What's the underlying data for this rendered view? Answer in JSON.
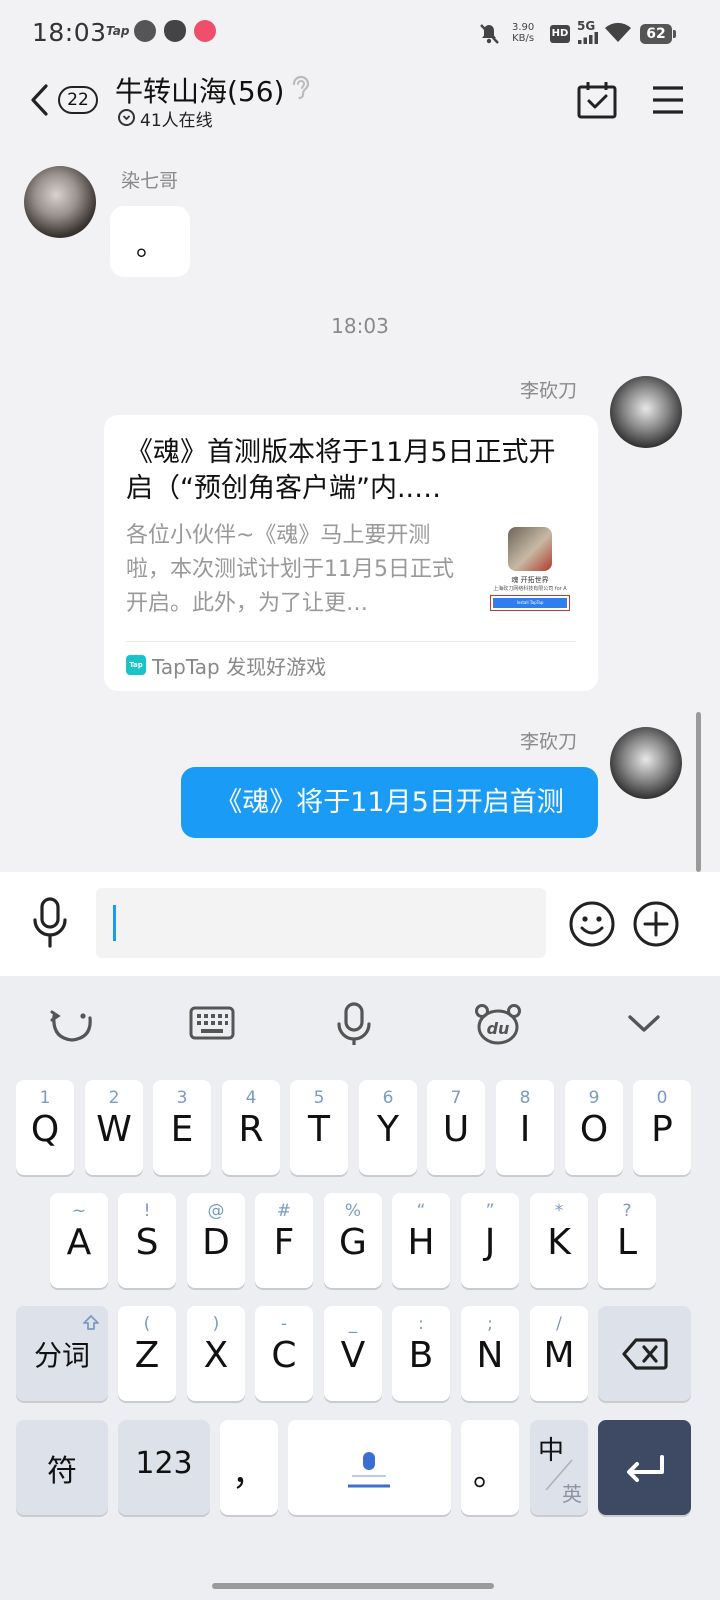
{
  "status_bar": {
    "time": "18:03",
    "app_tap": "Tap",
    "net_speed_value": "3.90",
    "net_speed_unit": "KB/s",
    "hd": "HD",
    "signal": "5G",
    "battery": "62"
  },
  "header": {
    "unread_count": "22",
    "title": "牛转山海(56)",
    "online": "41人在线"
  },
  "messages": {
    "msg1": {
      "sender": "染七哥",
      "text": "。"
    },
    "timestamp": "18:03",
    "msg2": {
      "sender": "李砍刀",
      "card_title": "《魂》首测版本将于11月5日正式开启（“预创角客户端”内..…",
      "card_desc": "各位小伙伴~《魂》马上要开测啦，本次测试计划于11月5日正式开启。此外，为了让更…",
      "thumb_line": "魂 开拓世界",
      "thumb_sub": "上海砍刀网络科技有限公司 for A",
      "thumb_btn": "Install TapTap",
      "source_logo": "Tap",
      "source": "TapTap 发现好游戏"
    },
    "msg3": {
      "sender": "李砍刀",
      "text": "《魂》将于11月5日开启首测"
    }
  },
  "input": {
    "value": "",
    "placeholder": ""
  },
  "keyboard": {
    "row1": [
      {
        "hint": "1",
        "key": "Q"
      },
      {
        "hint": "2",
        "key": "W"
      },
      {
        "hint": "3",
        "key": "E"
      },
      {
        "hint": "4",
        "key": "R"
      },
      {
        "hint": "5",
        "key": "T"
      },
      {
        "hint": "6",
        "key": "Y"
      },
      {
        "hint": "7",
        "key": "U"
      },
      {
        "hint": "8",
        "key": "I"
      },
      {
        "hint": "9",
        "key": "O"
      },
      {
        "hint": "0",
        "key": "P"
      }
    ],
    "row2": [
      {
        "hint": "~",
        "key": "A"
      },
      {
        "hint": "!",
        "key": "S"
      },
      {
        "hint": "@",
        "key": "D"
      },
      {
        "hint": "#",
        "key": "F"
      },
      {
        "hint": "%",
        "key": "G"
      },
      {
        "hint": "“",
        "key": "H"
      },
      {
        "hint": "”",
        "key": "J"
      },
      {
        "hint": "*",
        "key": "K"
      },
      {
        "hint": "?",
        "key": "L"
      }
    ],
    "row3": [
      {
        "hint": "(",
        "key": "Z"
      },
      {
        "hint": ")",
        "key": "X"
      },
      {
        "hint": "-",
        "key": "C"
      },
      {
        "hint": "_",
        "key": "V"
      },
      {
        "hint": ":",
        "key": "B"
      },
      {
        "hint": ";",
        "key": "N"
      },
      {
        "hint": "/",
        "key": "M"
      }
    ],
    "shift_label": "分词",
    "symbol_label": "符",
    "num_label": "123",
    "comma": "，",
    "period": "。",
    "lang_top": "中",
    "lang_bottom": "英"
  },
  "colors": {
    "accent": "#1a9cf6",
    "keyboard_bg": "#eceef1",
    "func_key": "#dde1ea",
    "enter_key": "#3e4a63",
    "hint": "#7a9bc4"
  }
}
